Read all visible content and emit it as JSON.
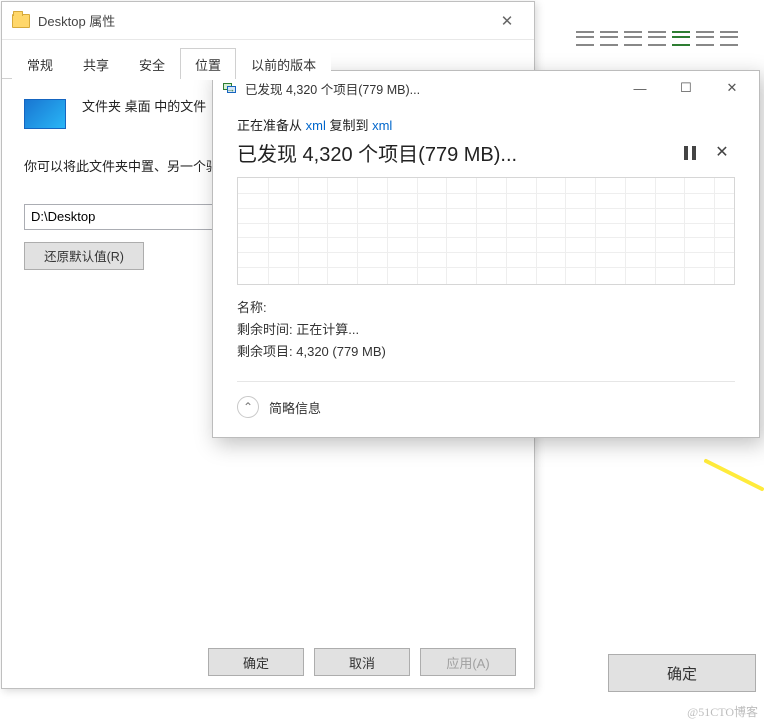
{
  "bg": {
    "ok_label": "确定"
  },
  "props": {
    "title": "Desktop 属性",
    "tabs": [
      "常规",
      "共享",
      "安全",
      "位置",
      "以前的版本"
    ],
    "active_tab_index": 3,
    "desc": "文件夹 桌面 中的文件",
    "note": "你可以将此文件夹中置、另一个驱动器或",
    "path_value": "D:\\Desktop",
    "restore_label": "还原默认值(R)",
    "buttons": {
      "ok": "确定",
      "cancel": "取消",
      "apply": "应用(A)"
    }
  },
  "copy": {
    "window_title": "已发现 4,320 个项目(779 MB)...",
    "prep_prefix": "正在准备从 ",
    "prep_src": "xml",
    "prep_mid": " 复制到 ",
    "prep_dst": "xml",
    "discover": "已发现 4,320 个项目(779 MB)...",
    "name_label": "名称:",
    "name_value": "",
    "remaining_time_label": "剩余时间:",
    "remaining_time_value": "正在计算...",
    "remaining_items_label": "剩余项目:",
    "remaining_items_value": "4,320 (779 MB)",
    "brief_label": "简略信息"
  },
  "watermark": "@51CTO博客"
}
